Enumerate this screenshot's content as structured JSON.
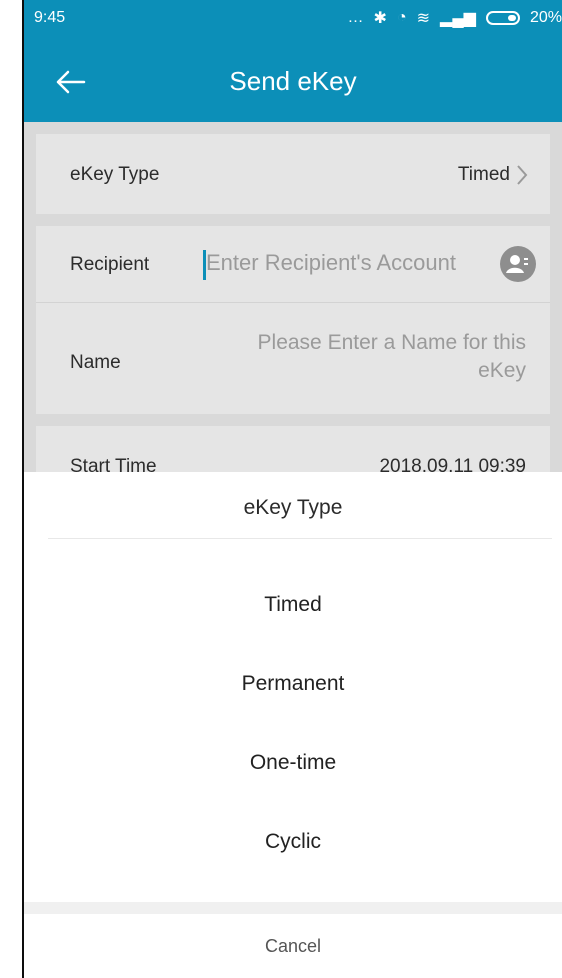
{
  "status_bar": {
    "time": "9:45",
    "battery": "20%"
  },
  "header": {
    "title": "Send eKey"
  },
  "form": {
    "ekey_type": {
      "label": "eKey Type",
      "value": "Timed"
    },
    "recipient": {
      "label": "Recipient",
      "placeholder": "Enter Recipient's Account"
    },
    "name": {
      "label": "Name",
      "placeholder_line1": "Please Enter a Name for this",
      "placeholder_line2": "eKey"
    },
    "start_time": {
      "label": "Start Time",
      "value": "2018.09.11 09:39"
    }
  },
  "sheet": {
    "title": "eKey Type",
    "options": [
      "Timed",
      "Permanent",
      "One-time",
      "Cyclic"
    ],
    "cancel_label": "Cancel"
  },
  "colors": {
    "primary": "#0c8fb8",
    "background": "#d9d9d9",
    "card": "#e5e5e5",
    "placeholder": "#9a9a9a"
  },
  "icons": {
    "back": "back-arrow-icon",
    "chevron": "chevron-right-icon",
    "contact": "contact-icon"
  }
}
